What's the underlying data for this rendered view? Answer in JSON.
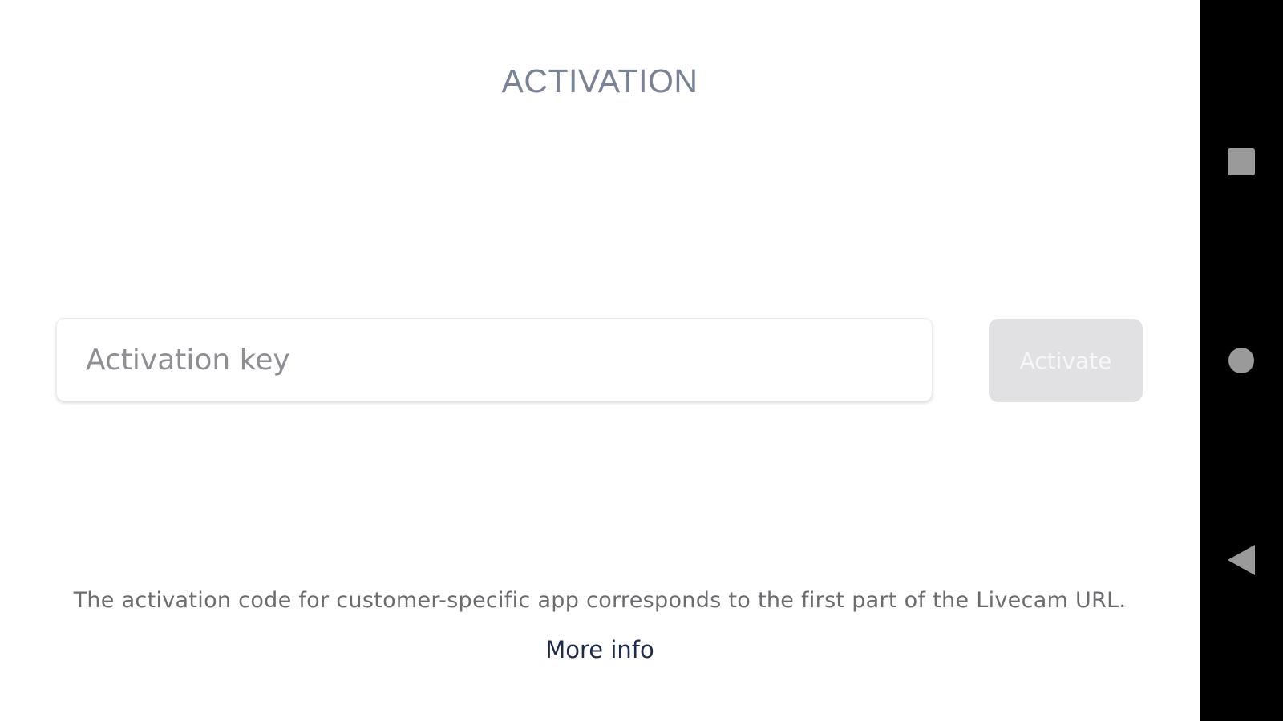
{
  "page": {
    "title": "ACTIVATION"
  },
  "activation": {
    "placeholder": "Activation key",
    "value": "",
    "button_label": "Activate"
  },
  "info": {
    "text": "The activation code for customer-specific app corresponds to the first part of the Livecam URL.",
    "link_label": "More info"
  },
  "navbar": {
    "recents_icon": "square-icon",
    "home_icon": "circle-icon",
    "back_icon": "triangle-back-icon"
  },
  "colors": {
    "title": "#7a8296",
    "button_disabled_bg": "#e1e1e4",
    "link": "#1e2a4a",
    "navbar_bg": "#000000",
    "nav_icon": "#9a9a9a"
  }
}
